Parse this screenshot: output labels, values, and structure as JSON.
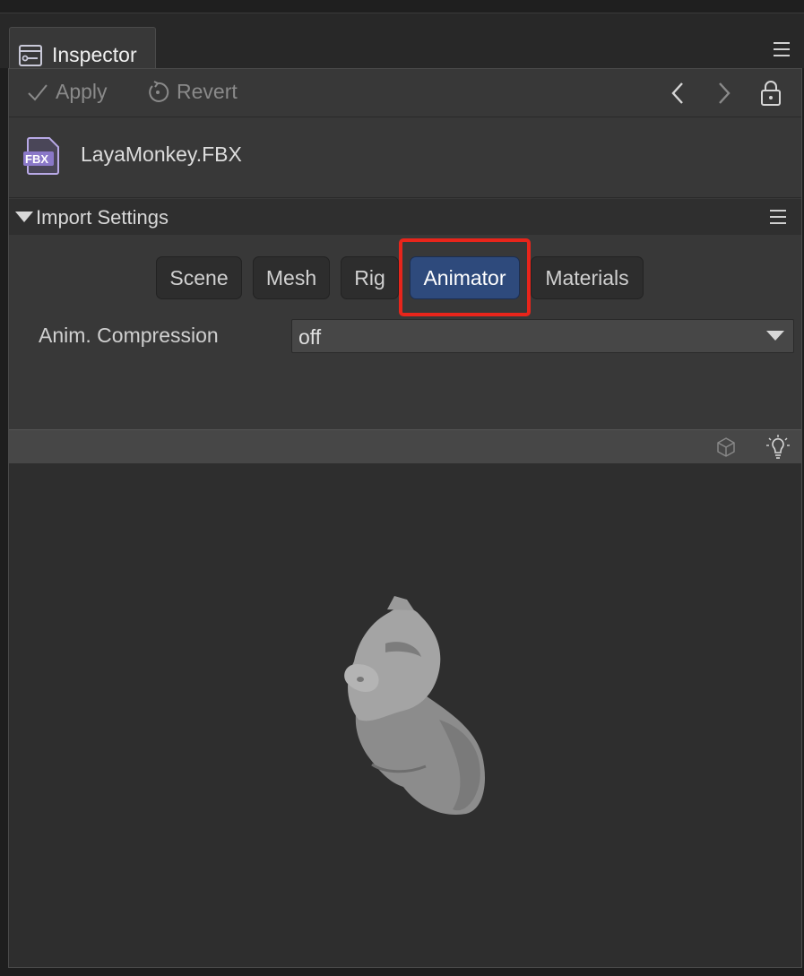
{
  "tab": {
    "title": "Inspector"
  },
  "toolbar": {
    "apply_label": "Apply",
    "revert_label": "Revert"
  },
  "file": {
    "icon_text": "FBX",
    "name": "LayaMonkey.FBX"
  },
  "import_settings": {
    "title": "Import Settings",
    "tabs": [
      "Scene",
      "Mesh",
      "Rig",
      "Animator",
      "Materials"
    ],
    "active_tab": "Animator"
  },
  "anim_compression": {
    "label": "Anim. Compression",
    "value": "off"
  },
  "colors": {
    "accent": "#2e4a7c",
    "highlight": "#e8251b"
  },
  "icons": [
    "inspector-icon",
    "menu-icon",
    "check-icon",
    "revert-icon",
    "chevron-left-icon",
    "chevron-right-icon",
    "lock-icon",
    "fbx-file-icon",
    "cube-icon",
    "lightbulb-icon"
  ]
}
